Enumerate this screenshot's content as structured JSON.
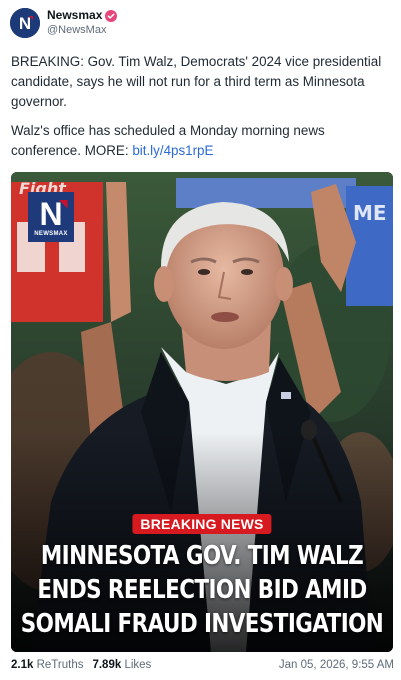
{
  "account": {
    "display_name": "Newsmax",
    "handle": "@NewsMax",
    "avatar_letter": "N",
    "verified_color": "#e8457a"
  },
  "post": {
    "paragraph1": "BREAKING: Gov. Tim Walz, Democrats' 2024 vice presidential candidate, says he will not run for a third term as Minnesota governor.",
    "paragraph2_text": "Walz's office has scheduled a Monday morning news conference. MORE: ",
    "link_text": "bit.ly/4ps1rpE"
  },
  "media": {
    "logo_letter": "N",
    "logo_text": "NEWSMAX",
    "badge": "BREAKING NEWS",
    "headline_lines": [
      "MINNESOTA GOV. TIM WALZ",
      "ENDS REELECTION BID AMID",
      "SOMALI FRAUD INVESTIGATION"
    ],
    "sign_text_left": "Fight",
    "sign_text_right": "ME"
  },
  "stats": {
    "retruths_count": "2.1k",
    "retruths_label": "ReTruths",
    "likes_count": "7.89k",
    "likes_label": "Likes",
    "timestamp": "Jan 05, 2026, 9:55 AM"
  },
  "colors": {
    "link": "#2a6bd6",
    "badge_red": "#d71920",
    "logo_blue": "#1e3a7a"
  }
}
